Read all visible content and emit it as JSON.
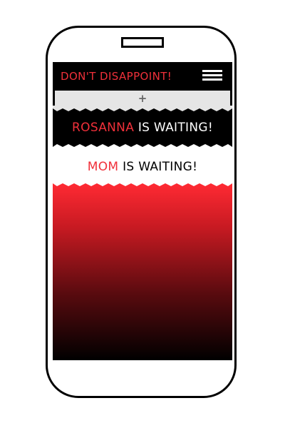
{
  "header": {
    "title": "DON'T DISAPPOINT!"
  },
  "add_bar": {
    "label": "+"
  },
  "waiting_items": [
    {
      "name": "ROSANNA",
      "suffix": " IS WAITING!"
    },
    {
      "name": "MOM",
      "suffix": " IS WAITING!"
    }
  ],
  "colors": {
    "accent": "#f0303a",
    "background": "#000000",
    "card": "#ffffff",
    "add_bar": "#e5e5e5"
  },
  "icons": {
    "menu": "hamburger-menu-icon",
    "add": "plus-icon"
  }
}
